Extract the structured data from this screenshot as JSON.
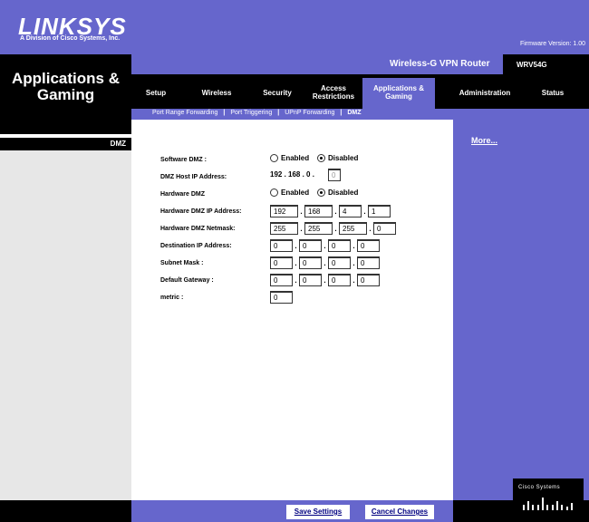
{
  "header": {
    "logo": "LINKSYS",
    "logo_sub": "A Division of Cisco Systems, Inc.",
    "firmware": "Firmware Version: 1.00"
  },
  "section_title": "Applications & Gaming",
  "product": "Wireless-G VPN Router",
  "model": "WRV54G",
  "tabs": [
    {
      "label": "Setup"
    },
    {
      "label": "Wireless"
    },
    {
      "label": "Security"
    },
    {
      "label": "Access Restrictions"
    },
    {
      "label": "Applications & Gaming"
    },
    {
      "label": "Administration"
    },
    {
      "label": "Status"
    }
  ],
  "subtabs": [
    {
      "label": "Port Range Forwarding"
    },
    {
      "label": "Port Triggering"
    },
    {
      "label": "UPnP Forwarding"
    },
    {
      "label": "DMZ"
    }
  ],
  "left_label": "DMZ",
  "more": "More...",
  "form": {
    "software_dmz": {
      "label": "Software DMZ :",
      "enabled": "Enabled",
      "disabled": "Disabled",
      "selected": "disabled"
    },
    "dmz_host_ip": {
      "label": "DMZ Host IP Address:",
      "prefix": "192 . 168 . 0 .",
      "last": "0"
    },
    "hardware_dmz": {
      "label": "Hardware DMZ",
      "enabled": "Enabled",
      "disabled": "Disabled",
      "selected": "disabled"
    },
    "hardware_ip": {
      "label": "Hardware DMZ IP Address:",
      "values": [
        "192",
        "168",
        "4",
        "1"
      ]
    },
    "hardware_mask": {
      "label": "Hardware DMZ Netmask:",
      "values": [
        "255",
        "255",
        "255",
        "0"
      ]
    },
    "dest_ip": {
      "label": "Destination IP Address:",
      "values": [
        "0",
        "0",
        "0",
        "0"
      ]
    },
    "subnet": {
      "label": "Subnet Mask :",
      "values": [
        "0",
        "0",
        "0",
        "0"
      ]
    },
    "gateway": {
      "label": "Default Gateway :",
      "values": [
        "0",
        "0",
        "0",
        "0"
      ]
    },
    "metric": {
      "label": "metric :",
      "value": "0"
    }
  },
  "footer": {
    "save": "Save Settings",
    "cancel": "Cancel Changes",
    "cisco": "Cisco Systems"
  },
  "colors": {
    "brand": "#6666cc",
    "dark": "#000000",
    "panel": "#e7e7e7"
  }
}
